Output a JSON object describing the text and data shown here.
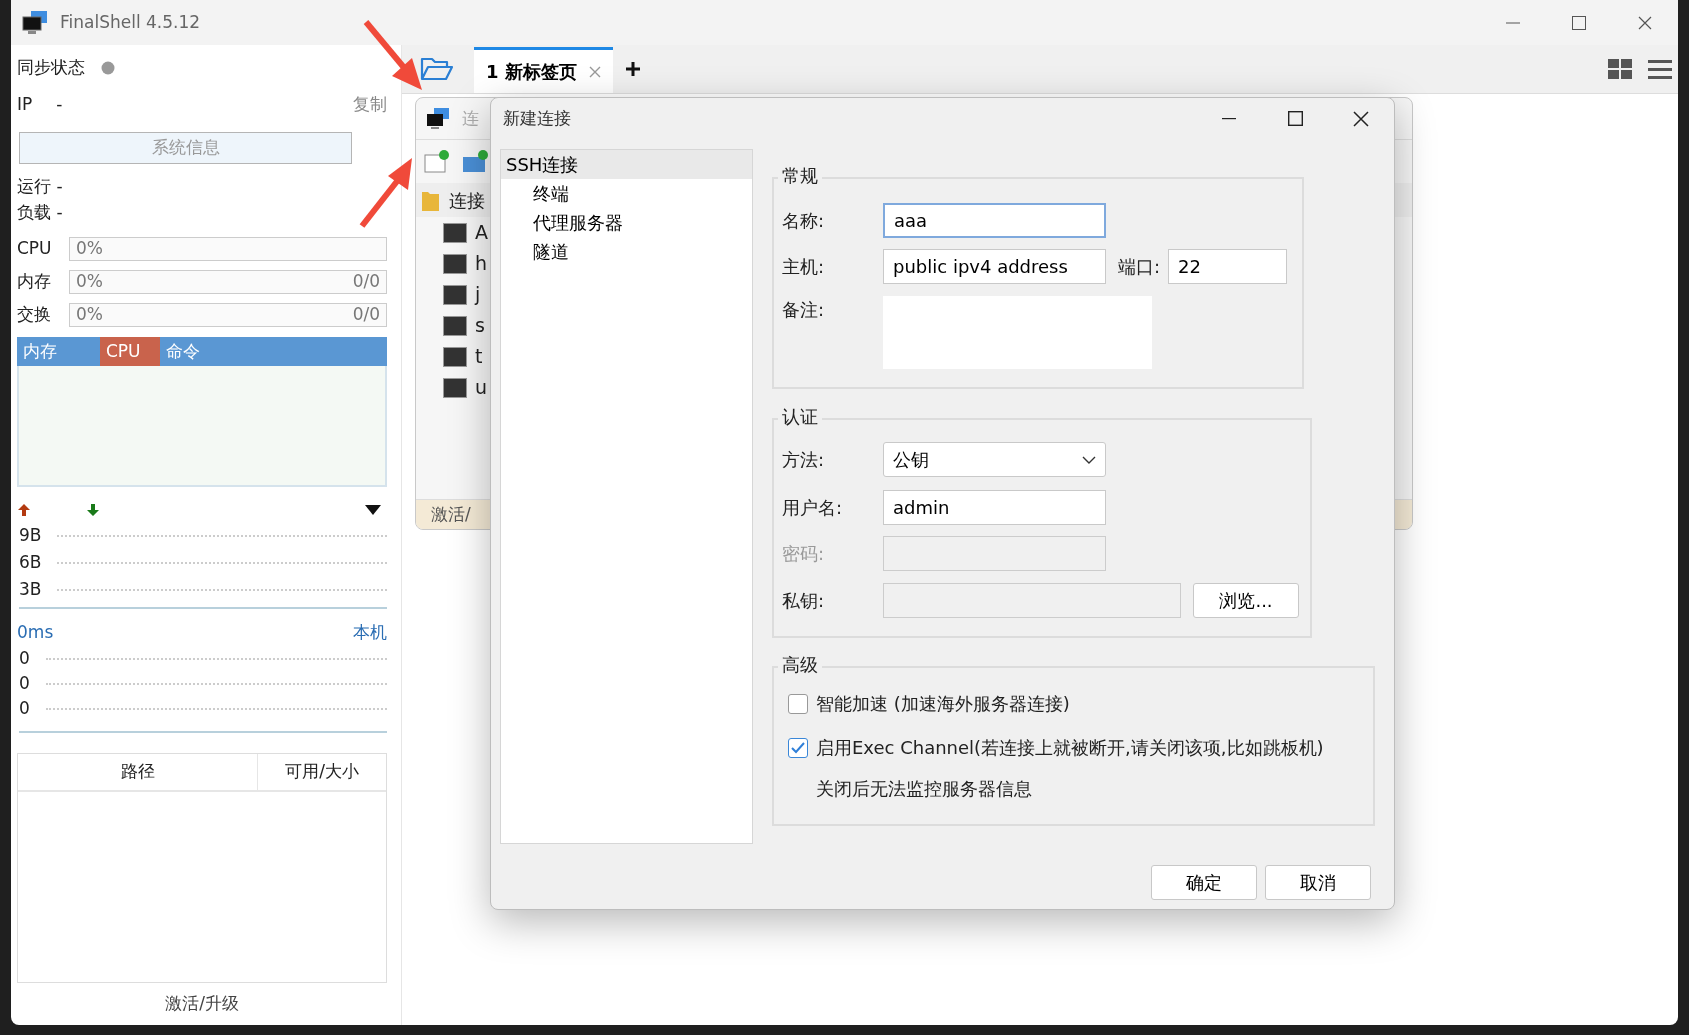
{
  "window": {
    "title": "FinalShell 4.5.12"
  },
  "sidebar": {
    "sync_label": "同步状态",
    "ip_label": "IP",
    "ip_value": "-",
    "copy_link": "复制",
    "sysinfo_button": "系统信息",
    "run_text": "运行 -",
    "load_text": "负载 -",
    "meters": [
      {
        "label": "CPU",
        "reading": "0%",
        "level": 0
      },
      {
        "label": "内存",
        "reading": "0%",
        "level": 0,
        "total": "0/0"
      },
      {
        "label": "交换",
        "reading": "0%",
        "level": 0,
        "total": "0/0"
      }
    ],
    "process_columns": [
      {
        "label": "内存",
        "selected": false
      },
      {
        "label": "CPU",
        "selected": true
      },
      {
        "label": "命令",
        "selected": false
      }
    ],
    "net_ticks": [
      "9B",
      "6B",
      "3B"
    ],
    "ping": {
      "latency": "0ms",
      "host": "本机",
      "ticks": [
        "0",
        "0",
        "0"
      ]
    },
    "disk_columns": [
      "路径",
      "可用/大小"
    ],
    "footer": "激活/升级"
  },
  "tabs": [
    {
      "label": "1 新标签页",
      "selected": true
    }
  ],
  "manager": {
    "title": "连",
    "root": "连接",
    "items": [
      "A",
      "h",
      "j",
      "s",
      "t",
      "u"
    ],
    "footer": "激活/"
  },
  "dialog": {
    "title": "新建连接",
    "nav": [
      {
        "label": "SSH连接",
        "selected": true,
        "children": [
          {
            "label": "终端",
            "selected": false
          },
          {
            "label": "代理服务器",
            "selected": false
          },
          {
            "label": "隧道",
            "selected": false
          }
        ]
      }
    ],
    "general": {
      "legend": "常规",
      "name_label": "名称:",
      "name_value": "aaa",
      "name_focused": true,
      "host_label": "主机:",
      "host_value": "public ipv4 address",
      "port_label": "端口:",
      "port_value": "22",
      "note_label": "备注:"
    },
    "auth": {
      "legend": "认证",
      "method_label": "方法:",
      "method_value": "公钥",
      "user_label": "用户名:",
      "user_value": "admin",
      "password_label": "密码:",
      "password_disabled": true,
      "key_label": "私钥:",
      "browse_button": "浏览..."
    },
    "advanced": {
      "legend": "高级",
      "options": [
        {
          "label": "智能加速 (加速海外服务器连接)",
          "checked": false
        },
        {
          "label": "启用Exec Channel(若连接上就被断开,请关闭该项,比如跳板机)",
          "checked": true,
          "note": "关闭后无法监控服务器信息"
        }
      ]
    },
    "buttons": [
      "确定",
      "取消"
    ]
  }
}
